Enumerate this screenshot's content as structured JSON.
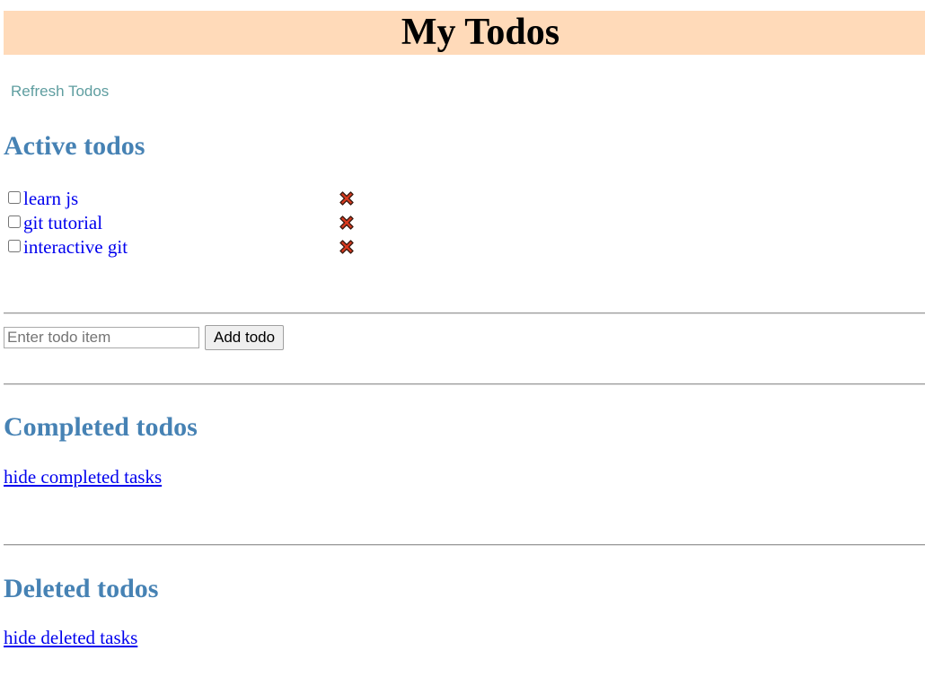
{
  "header": {
    "title": "My Todos",
    "background_color": "#ffdab9"
  },
  "actions": {
    "refresh_label": "Refresh Todos"
  },
  "active_section": {
    "heading": "Active todos",
    "items": [
      {
        "text": "learn js",
        "checked": false,
        "delete_icon": "close-x-icon"
      },
      {
        "text": "git tutorial",
        "checked": false,
        "delete_icon": "close-x-icon"
      },
      {
        "text": "interactive git",
        "checked": false,
        "delete_icon": "close-x-icon"
      }
    ]
  },
  "add_form": {
    "input_value": "",
    "input_placeholder": "Enter todo item",
    "button_label": "Add todo"
  },
  "completed_section": {
    "heading": "Completed todos",
    "toggle_label": "hide completed tasks"
  },
  "deleted_section": {
    "heading": "Deleted todos",
    "toggle_label": "hide deleted tasks"
  },
  "colors": {
    "heading": "#4682b4",
    "link": "#0000ee",
    "refresh": "#5f9ea0",
    "delete_icon_fill": "#d93a1f"
  }
}
